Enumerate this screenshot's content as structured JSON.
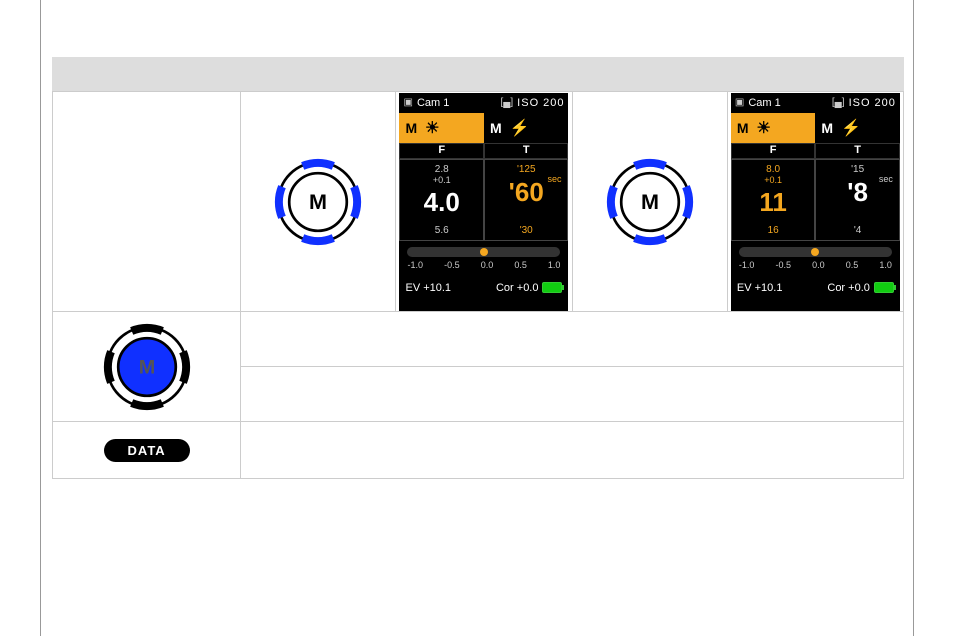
{
  "dial": {
    "letter_outline": "M",
    "letter_filled": "M"
  },
  "data_key_label": "DATA",
  "panel_a": {
    "cam_label": "Cam 1",
    "iso_label": "ISO",
    "iso_value": "200",
    "mode_left_letter": "M",
    "mode_right_letter": "M",
    "f_header": "F",
    "t_header": "T",
    "f_top": "2.8",
    "f_inc": "+0.1",
    "f_big": "4.0",
    "f_bot": "5.6",
    "t_top": "'125",
    "t_sec": "sec",
    "t_big": "'60",
    "t_bot": "'30",
    "scale": {
      "t0": "-1.0",
      "t1": "-0.5",
      "t2": "0.0",
      "t3": "0.5",
      "t4": "1.0"
    },
    "ev": "EV +10.1",
    "cor": "Cor +0.0"
  },
  "panel_b": {
    "cam_label": "Cam 1",
    "iso_label": "ISO",
    "iso_value": "200",
    "mode_left_letter": "M",
    "mode_right_letter": "M",
    "f_header": "F",
    "t_header": "T",
    "f_top": "8.0",
    "f_inc": "+0.1",
    "f_big": "11",
    "f_bot": "16",
    "t_top": "'15",
    "t_sec": "sec",
    "t_big": "'8",
    "t_bot": "'4",
    "scale": {
      "t0": "-1.0",
      "t1": "-0.5",
      "t2": "0.0",
      "t3": "0.5",
      "t4": "1.0"
    },
    "ev": "EV +10.1",
    "cor": "Cor +0.0"
  }
}
